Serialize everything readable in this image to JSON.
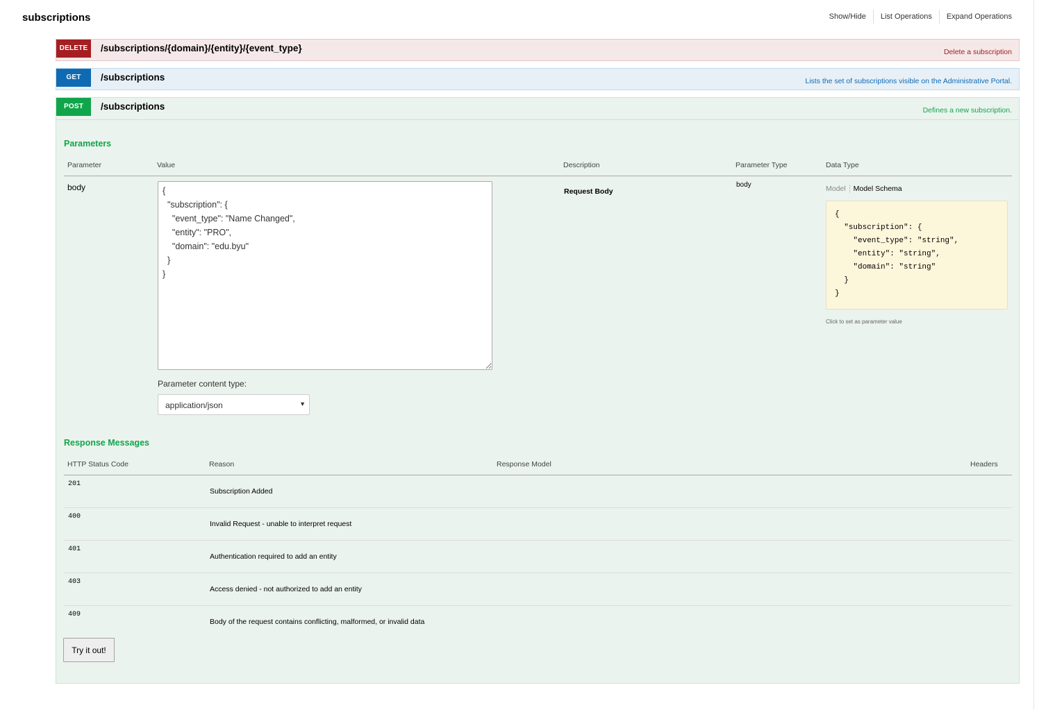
{
  "resource": {
    "title": "subscriptions",
    "actions": [
      "Show/Hide",
      "List Operations",
      "Expand Operations"
    ]
  },
  "operations": [
    {
      "method": "DELETE",
      "path": "/subscriptions/{domain}/{entity}/{event_type}",
      "summary": "Delete a subscription",
      "color": "#a41e22"
    },
    {
      "method": "GET",
      "path": "/subscriptions",
      "summary": "Lists the set of subscriptions visible on the Administrative Portal.",
      "color": "#0f6ab4"
    },
    {
      "method": "POST",
      "path": "/subscriptions",
      "summary": "Defines a new subscription.",
      "color": "#10a54a"
    }
  ],
  "parameters": {
    "title": "Parameters",
    "headers": [
      "Parameter",
      "Value",
      "Description",
      "Parameter Type",
      "Data Type"
    ],
    "row": {
      "name": "body",
      "value": "{\n  \"subscription\": {\n    \"event_type\": \"Name Changed\",\n    \"entity\": \"PRO\",\n    \"domain\": \"edu.byu\"\n  }\n}",
      "description": "Request Body",
      "param_type": "body",
      "tabs": [
        "Model",
        "Model Schema"
      ],
      "schema": "{\n  \"subscription\": {\n    \"event_type\": \"string\",\n    \"entity\": \"string\",\n    \"domain\": \"string\"\n  }\n}",
      "schema_hint": "Click to set as parameter value"
    },
    "content_type_label": "Parameter content type:",
    "content_type": "application/json"
  },
  "responses": {
    "title": "Response Messages",
    "headers": [
      "HTTP Status Code",
      "Reason",
      "Response Model",
      "Headers"
    ],
    "rows": [
      {
        "code": "201",
        "reason": "Subscription Added"
      },
      {
        "code": "400",
        "reason": "Invalid Request - unable to interpret request"
      },
      {
        "code": "401",
        "reason": "Authentication required to add an entity"
      },
      {
        "code": "403",
        "reason": "Access denied - not authorized to add an entity"
      },
      {
        "code": "409",
        "reason": "Body of the request contains conflicting, malformed, or invalid data"
      }
    ]
  },
  "try_button": "Try it out!"
}
